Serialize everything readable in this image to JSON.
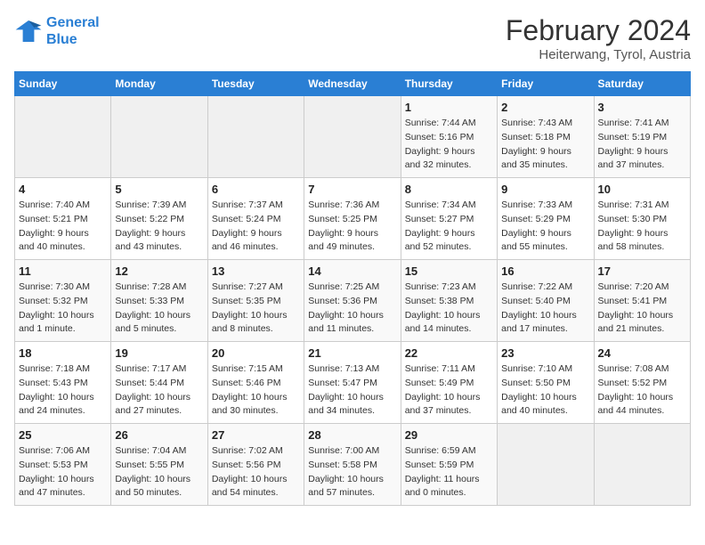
{
  "header": {
    "logo_line1": "General",
    "logo_line2": "Blue",
    "title": "February 2024",
    "subtitle": "Heiterwang, Tyrol, Austria"
  },
  "weekdays": [
    "Sunday",
    "Monday",
    "Tuesday",
    "Wednesday",
    "Thursday",
    "Friday",
    "Saturday"
  ],
  "weeks": [
    [
      {
        "num": "",
        "info": ""
      },
      {
        "num": "",
        "info": ""
      },
      {
        "num": "",
        "info": ""
      },
      {
        "num": "",
        "info": ""
      },
      {
        "num": "1",
        "info": "Sunrise: 7:44 AM\nSunset: 5:16 PM\nDaylight: 9 hours\nand 32 minutes."
      },
      {
        "num": "2",
        "info": "Sunrise: 7:43 AM\nSunset: 5:18 PM\nDaylight: 9 hours\nand 35 minutes."
      },
      {
        "num": "3",
        "info": "Sunrise: 7:41 AM\nSunset: 5:19 PM\nDaylight: 9 hours\nand 37 minutes."
      }
    ],
    [
      {
        "num": "4",
        "info": "Sunrise: 7:40 AM\nSunset: 5:21 PM\nDaylight: 9 hours\nand 40 minutes."
      },
      {
        "num": "5",
        "info": "Sunrise: 7:39 AM\nSunset: 5:22 PM\nDaylight: 9 hours\nand 43 minutes."
      },
      {
        "num": "6",
        "info": "Sunrise: 7:37 AM\nSunset: 5:24 PM\nDaylight: 9 hours\nand 46 minutes."
      },
      {
        "num": "7",
        "info": "Sunrise: 7:36 AM\nSunset: 5:25 PM\nDaylight: 9 hours\nand 49 minutes."
      },
      {
        "num": "8",
        "info": "Sunrise: 7:34 AM\nSunset: 5:27 PM\nDaylight: 9 hours\nand 52 minutes."
      },
      {
        "num": "9",
        "info": "Sunrise: 7:33 AM\nSunset: 5:29 PM\nDaylight: 9 hours\nand 55 minutes."
      },
      {
        "num": "10",
        "info": "Sunrise: 7:31 AM\nSunset: 5:30 PM\nDaylight: 9 hours\nand 58 minutes."
      }
    ],
    [
      {
        "num": "11",
        "info": "Sunrise: 7:30 AM\nSunset: 5:32 PM\nDaylight: 10 hours\nand 1 minute."
      },
      {
        "num": "12",
        "info": "Sunrise: 7:28 AM\nSunset: 5:33 PM\nDaylight: 10 hours\nand 5 minutes."
      },
      {
        "num": "13",
        "info": "Sunrise: 7:27 AM\nSunset: 5:35 PM\nDaylight: 10 hours\nand 8 minutes."
      },
      {
        "num": "14",
        "info": "Sunrise: 7:25 AM\nSunset: 5:36 PM\nDaylight: 10 hours\nand 11 minutes."
      },
      {
        "num": "15",
        "info": "Sunrise: 7:23 AM\nSunset: 5:38 PM\nDaylight: 10 hours\nand 14 minutes."
      },
      {
        "num": "16",
        "info": "Sunrise: 7:22 AM\nSunset: 5:40 PM\nDaylight: 10 hours\nand 17 minutes."
      },
      {
        "num": "17",
        "info": "Sunrise: 7:20 AM\nSunset: 5:41 PM\nDaylight: 10 hours\nand 21 minutes."
      }
    ],
    [
      {
        "num": "18",
        "info": "Sunrise: 7:18 AM\nSunset: 5:43 PM\nDaylight: 10 hours\nand 24 minutes."
      },
      {
        "num": "19",
        "info": "Sunrise: 7:17 AM\nSunset: 5:44 PM\nDaylight: 10 hours\nand 27 minutes."
      },
      {
        "num": "20",
        "info": "Sunrise: 7:15 AM\nSunset: 5:46 PM\nDaylight: 10 hours\nand 30 minutes."
      },
      {
        "num": "21",
        "info": "Sunrise: 7:13 AM\nSunset: 5:47 PM\nDaylight: 10 hours\nand 34 minutes."
      },
      {
        "num": "22",
        "info": "Sunrise: 7:11 AM\nSunset: 5:49 PM\nDaylight: 10 hours\nand 37 minutes."
      },
      {
        "num": "23",
        "info": "Sunrise: 7:10 AM\nSunset: 5:50 PM\nDaylight: 10 hours\nand 40 minutes."
      },
      {
        "num": "24",
        "info": "Sunrise: 7:08 AM\nSunset: 5:52 PM\nDaylight: 10 hours\nand 44 minutes."
      }
    ],
    [
      {
        "num": "25",
        "info": "Sunrise: 7:06 AM\nSunset: 5:53 PM\nDaylight: 10 hours\nand 47 minutes."
      },
      {
        "num": "26",
        "info": "Sunrise: 7:04 AM\nSunset: 5:55 PM\nDaylight: 10 hours\nand 50 minutes."
      },
      {
        "num": "27",
        "info": "Sunrise: 7:02 AM\nSunset: 5:56 PM\nDaylight: 10 hours\nand 54 minutes."
      },
      {
        "num": "28",
        "info": "Sunrise: 7:00 AM\nSunset: 5:58 PM\nDaylight: 10 hours\nand 57 minutes."
      },
      {
        "num": "29",
        "info": "Sunrise: 6:59 AM\nSunset: 5:59 PM\nDaylight: 11 hours\nand 0 minutes."
      },
      {
        "num": "",
        "info": ""
      },
      {
        "num": "",
        "info": ""
      }
    ]
  ]
}
